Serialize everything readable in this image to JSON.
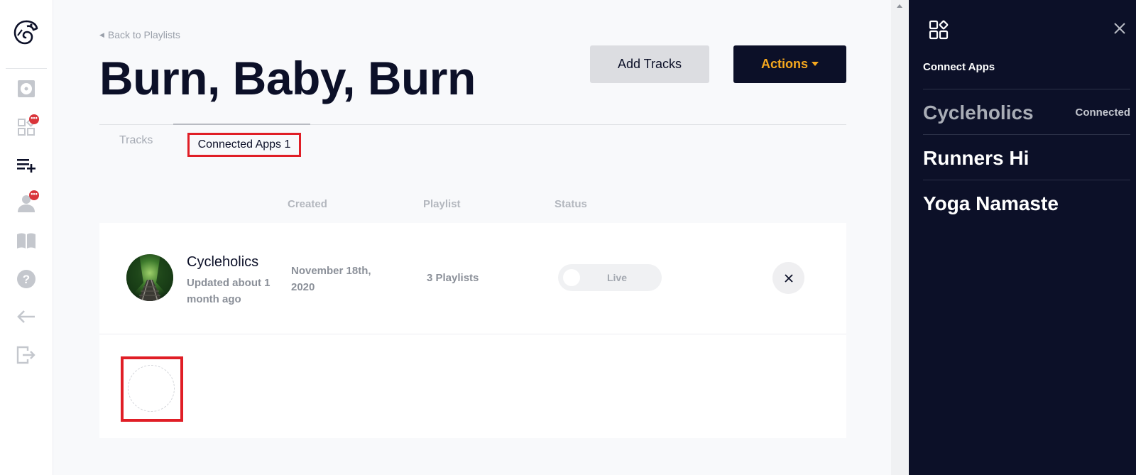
{
  "nav": {
    "items": [
      {
        "name": "records-icon",
        "badge": ""
      },
      {
        "name": "apps-icon",
        "badge": "•••"
      },
      {
        "name": "playlist-add-icon",
        "badge": ""
      },
      {
        "name": "user-icon",
        "badge": "•••"
      },
      {
        "name": "book-icon",
        "badge": ""
      },
      {
        "name": "help-icon",
        "badge": ""
      },
      {
        "name": "arrow-left-icon",
        "badge": ""
      },
      {
        "name": "logout-icon",
        "badge": ""
      }
    ]
  },
  "header": {
    "back_label": "Back to Playlists",
    "title": "Burn, Baby, Burn",
    "add_tracks_label": "Add Tracks",
    "actions_label": "Actions"
  },
  "tabs": [
    {
      "label": "Tracks",
      "active": false
    },
    {
      "label": "Connected Apps 1",
      "active": true
    }
  ],
  "table": {
    "columns": [
      "Created",
      "Playlist",
      "Status"
    ],
    "rows": [
      {
        "app_name": "Cycleholics",
        "updated": "Updated about 1 month ago",
        "created": "November 18th, 2020",
        "playlists": "3 Playlists",
        "status": "Live"
      }
    ]
  },
  "drawer": {
    "heading": "Connect Apps",
    "apps": [
      {
        "name": "Cycleholics",
        "status": "Connected"
      },
      {
        "name": "Runners Hi",
        "status": ""
      },
      {
        "name": "Yoga Namaste",
        "status": ""
      }
    ]
  },
  "colors": {
    "navy": "#0c1028",
    "accent": "#f6a81e",
    "highlight": "#e01e26"
  }
}
